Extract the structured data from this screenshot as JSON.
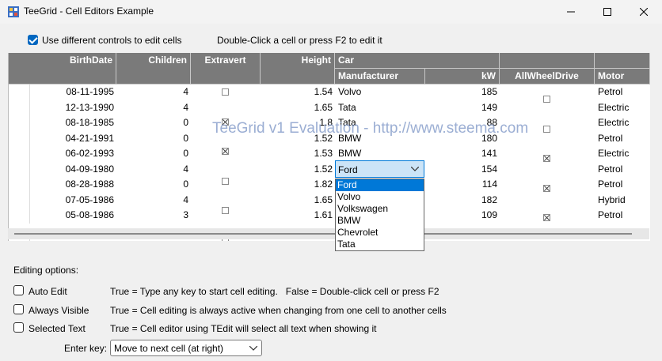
{
  "window": {
    "title": "TeeGrid - Cell Editors Example"
  },
  "top": {
    "use_controls_label": "Use different controls to edit cells",
    "use_controls_checked": true,
    "hint": "Double-Click a cell or press F2 to edit it"
  },
  "grid": {
    "headers": {
      "birthdate": "BirthDate",
      "children": "Children",
      "extravert": "Extravert",
      "height": "Height",
      "car": "Car",
      "manufacturer": "Manufacturer",
      "kw": "kW",
      "allwheel": "AllWheelDrive",
      "motor": "Motor"
    },
    "rows": [
      {
        "birthdate": "08-11-1995",
        "children": "4",
        "extravert": false,
        "height": "1.54",
        "manufacturer": "Volvo",
        "kw": "185",
        "allwheel": false,
        "motor": "Petrol"
      },
      {
        "birthdate": "12-13-1990",
        "children": "4",
        "extravert": true,
        "height": "1.65",
        "manufacturer": "Tata",
        "kw": "149",
        "allwheel": false,
        "motor": "Electric"
      },
      {
        "birthdate": "08-18-1985",
        "children": "0",
        "extravert": true,
        "height": "1.8",
        "manufacturer": "Tata",
        "kw": "88",
        "allwheel": true,
        "motor": "Electric"
      },
      {
        "birthdate": "04-21-1991",
        "children": "0",
        "extravert": false,
        "height": "1.52",
        "manufacturer": "BMW",
        "kw": "180",
        "allwheel": true,
        "motor": "Petrol"
      },
      {
        "birthdate": "06-02-1993",
        "children": "0",
        "extravert": false,
        "height": "1.53",
        "manufacturer": "BMW",
        "kw": "141",
        "allwheel": true,
        "motor": "Electric"
      },
      {
        "birthdate": "04-09-1980",
        "children": "4",
        "extravert": false,
        "height": "1.52",
        "manufacturer": "",
        "kw": "154",
        "allwheel": false,
        "motor": "Petrol"
      },
      {
        "birthdate": "08-28-1988",
        "children": "0",
        "extravert": false,
        "height": "1.82",
        "manufacturer": "",
        "kw": "114",
        "allwheel": true,
        "motor": "Petrol"
      },
      {
        "birthdate": "07-05-1986",
        "children": "4",
        "extravert": false,
        "height": "1.65",
        "manufacturer": "",
        "kw": "182",
        "allwheel": true,
        "motor": "Hybrid"
      },
      {
        "birthdate": "05-08-1986",
        "children": "3",
        "extravert": true,
        "height": "1.61",
        "manufacturer": "",
        "kw": "109",
        "allwheel": false,
        "motor": "Petrol"
      }
    ],
    "watermark": "TeeGrid v1 Evaluation - http://www.steema.com"
  },
  "dropdown": {
    "value": "Ford",
    "options": [
      "Ford",
      "Volvo",
      "Volkswagen",
      "BMW",
      "Chevrolet",
      "Tata"
    ]
  },
  "options": {
    "heading": "Editing options:",
    "items": [
      {
        "label": "Auto Edit",
        "desc": "True = Type any key to start cell editing.   False = Double-click cell or press F2",
        "checked": false
      },
      {
        "label": "Always Visible",
        "desc": "True = Cell editing is always active when changing from one cell to another cells",
        "checked": false
      },
      {
        "label": "Selected Text",
        "desc": "True = Cell editor using TEdit will select all text when showing it",
        "checked": false
      }
    ],
    "enter_key_label": "Enter key:",
    "enter_key_value": "Move to next cell (at right)"
  },
  "colors": {
    "header_bg": "#7a7a7a",
    "accent": "#0078d7",
    "watermark": "#8aa0cc"
  }
}
